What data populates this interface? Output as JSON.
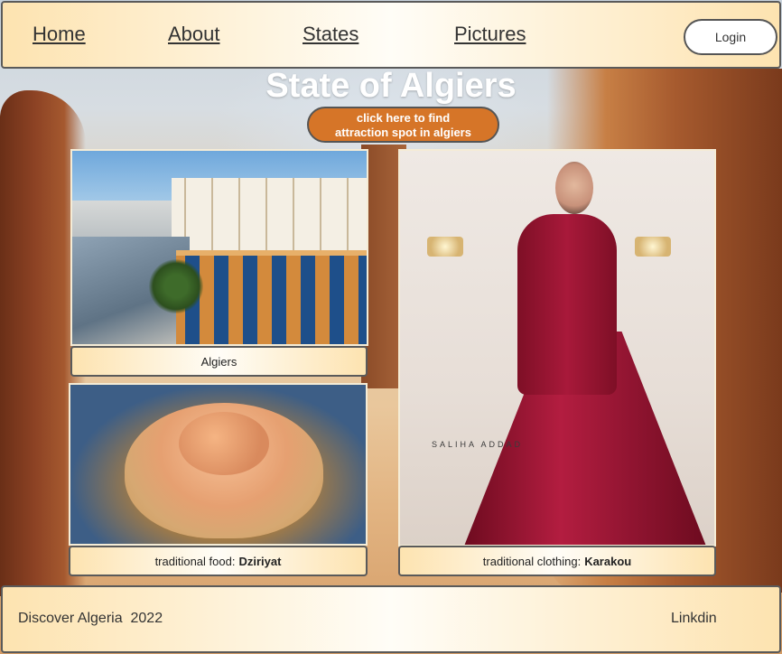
{
  "nav": {
    "links": [
      "Home",
      "About",
      "States",
      "Pictures"
    ],
    "login_label": "Login"
  },
  "main": {
    "title": "State of Algiers",
    "cta_line1": "click here to find",
    "cta_line2": "attraction spot in algiers",
    "cards": [
      {
        "caption": "Algiers"
      },
      {
        "caption_prefix": "traditional food:",
        "caption_bold": "Dziriyat"
      },
      {
        "caption_prefix": "traditional clothing:",
        "caption_bold": "Karakou",
        "watermark": "SALIHA ADDAD"
      }
    ]
  },
  "footer": {
    "left_text": "Discover Algeria  2022",
    "right_link": "Linkdin"
  }
}
